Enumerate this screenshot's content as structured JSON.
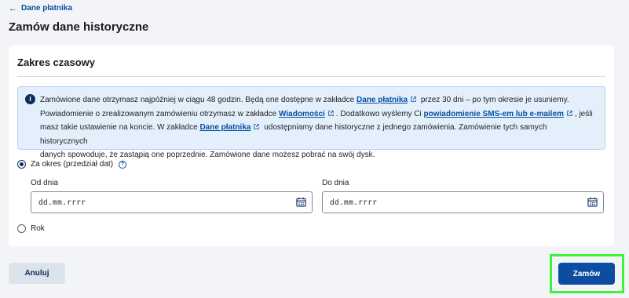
{
  "breadcrumb": {
    "back_label": "Dane płatnika"
  },
  "page": {
    "title": "Zamów dane historyczne"
  },
  "card": {
    "title": "Zakres czasowy",
    "info": {
      "line1_a": "Zamówione dane otrzymasz najpóźniej w ciągu 48 godzin. Będą one dostępne w zakładce ",
      "link_dane_platnika_1": "Dane płatnika",
      "line1_b": " przez 30 dni – po tym okresie je usuniemy.",
      "line2_a": "Powiadomienie o zrealizowanym zamówieniu otrzymasz w zakładce ",
      "link_wiadomosci": "Wiadomości",
      "line2_b": ". Dodatkowo wyślemy Ci ",
      "link_powiadomienie": "powiadomienie SMS-em lub e-mailem",
      "line2_c": ", jeśli",
      "line3_a": "masz takie ustawienie na koncie. W zakładce ",
      "link_dane_platnika_2": "Dane płatnika",
      "line3_b": " udostępniamy dane historyczne z jednego zamówienia. Zamówienie tych samych historycznych",
      "line4": "danych spowoduje, że zastąpią one poprzednie. Zamówione dane możesz pobrać na swój dysk."
    },
    "options": {
      "range_label": "Za okres (przedział dat)",
      "range_help": "?",
      "year_label": "Rok"
    },
    "from": {
      "label": "Od dnia",
      "placeholder": "dd.mm.rrrr"
    },
    "to": {
      "label": "Do dnia",
      "placeholder": "dd.mm.rrrr"
    }
  },
  "actions": {
    "cancel_label": "Anuluj",
    "order_label": "Zamów"
  },
  "colors": {
    "accent": "#0c4da2",
    "highlight": "#3ef23a",
    "info_bg": "#e3f0fc"
  }
}
